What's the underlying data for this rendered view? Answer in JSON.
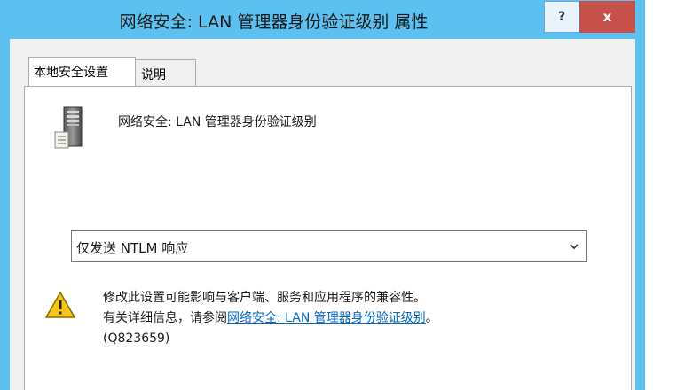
{
  "window": {
    "title": "网络安全: LAN 管理器身份验证级别 属性",
    "help_label": "?",
    "close_label": "x"
  },
  "tabs": [
    {
      "label": "本地安全设置",
      "active": true
    },
    {
      "label": "说明",
      "active": false
    }
  ],
  "policy": {
    "name": "网络安全: LAN 管理器身份验证级别"
  },
  "dropdown": {
    "selected": "仅发送 NTLM 响应"
  },
  "warning": {
    "line1": "修改此设置可能影响与客户端、服务和应用程序的兼容性。",
    "line2_prefix": "有关详细信息，请参阅",
    "link_text": "网络安全: LAN 管理器身份验证级别",
    "line2_suffix": "。",
    "line3": "(Q823659)"
  },
  "icons": {
    "server": "server-icon",
    "warning": "warning-icon",
    "dropdown": "chevron-down-icon"
  },
  "colors": {
    "titlebar": "#5cc0f0",
    "close_button": "#c7504a",
    "link": "#0066cc"
  }
}
